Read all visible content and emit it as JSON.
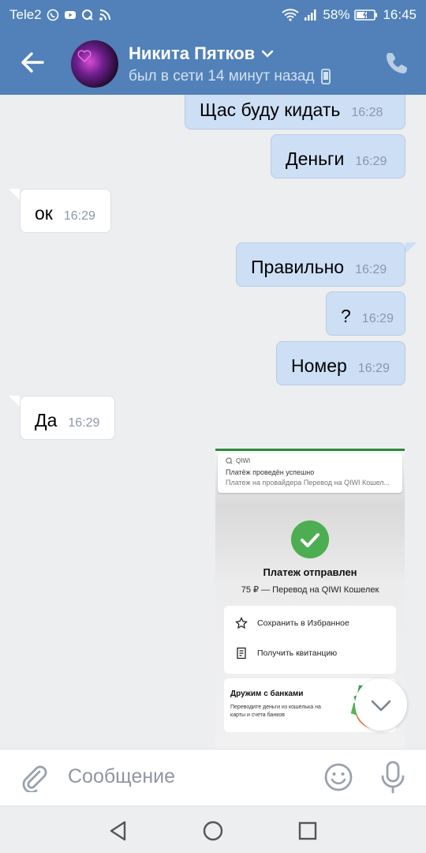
{
  "status_bar": {
    "carrier": "Tele2",
    "battery": "58%",
    "time": "16:45"
  },
  "header": {
    "contact_name": "Никита Пятков",
    "last_seen": "был в сети 14 минут назад"
  },
  "messages": [
    {
      "direction": "out",
      "text": "Щас буду кидать",
      "time": "16:28"
    },
    {
      "direction": "out",
      "text": "Деньги",
      "time": "16:29"
    },
    {
      "direction": "in",
      "text": "ок",
      "time": "16:29"
    },
    {
      "direction": "out",
      "text": "Правильно",
      "time": "16:29"
    },
    {
      "direction": "out",
      "text": "?",
      "time": "16:29"
    },
    {
      "direction": "out",
      "text": "Номер",
      "time": "16:29"
    },
    {
      "direction": "in",
      "text": "Да",
      "time": "16:29"
    }
  ],
  "attachment": {
    "notification": {
      "app": "QIWI",
      "title": "Платёж проведён успешно",
      "body": "Платеж на провайдера Перевод на QIWI Кошел..."
    },
    "payment_title": "Платеж отправлен",
    "payment_subtitle": "75 ₽ — Перевод на QIWI Кошелек",
    "actions": [
      "Сохранить в Избранное",
      "Получить квитанцию"
    ],
    "promo_title": "Дружим с банками",
    "promo_text": "Переводите деньги из кошелька на карты и счета банков"
  },
  "composer": {
    "placeholder": "Сообщение"
  },
  "colors": {
    "header": "#5181b8",
    "bubble_out": "#cddff5",
    "bubble_in": "#ffffff",
    "success": "#4cae50"
  }
}
